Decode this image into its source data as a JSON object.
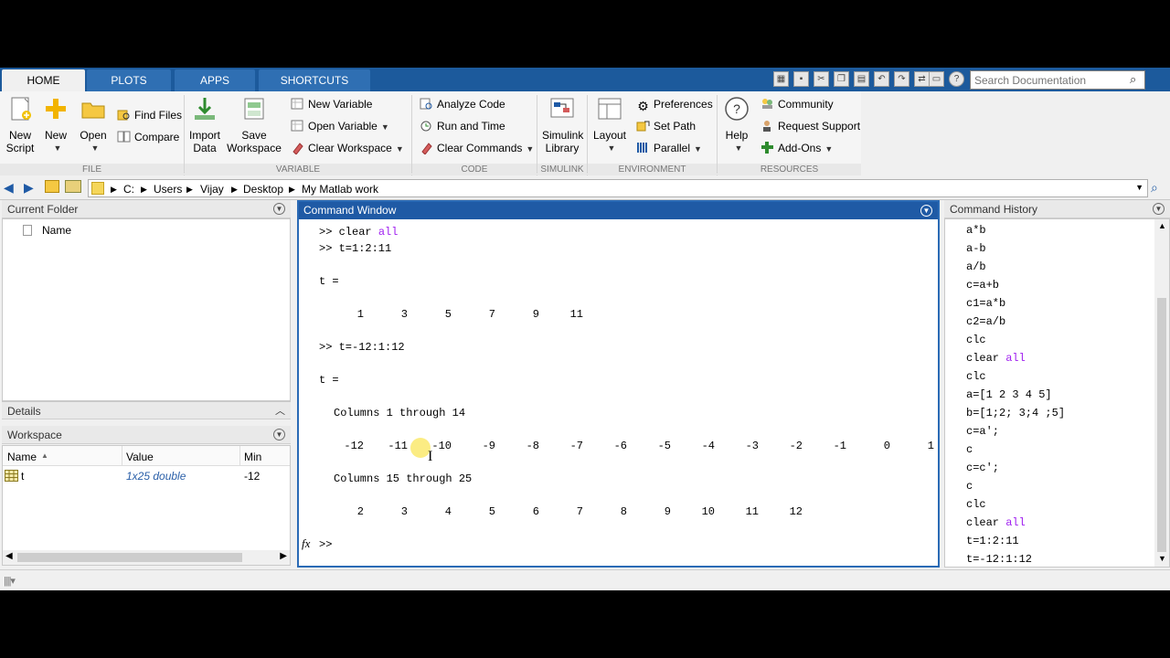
{
  "tabs": [
    "HOME",
    "PLOTS",
    "APPS",
    "SHORTCUTS"
  ],
  "search": {
    "placeholder": "Search Documentation"
  },
  "ribbon": {
    "file": {
      "label": "FILE",
      "new_script": [
        "New",
        "Script"
      ],
      "new": "New",
      "open": "Open",
      "find_files": "Find Files",
      "compare": "Compare"
    },
    "variable": {
      "label": "VARIABLE",
      "import_data": [
        "Import",
        "Data"
      ],
      "save_workspace": [
        "Save",
        "Workspace"
      ],
      "new_variable": "New Variable",
      "open_variable": "Open Variable",
      "clear_workspace": "Clear Workspace"
    },
    "code": {
      "label": "CODE",
      "analyze_code": "Analyze Code",
      "run_and_time": "Run and Time",
      "clear_commands": "Clear Commands"
    },
    "simulink": {
      "label": "SIMULINK",
      "simulink_library": [
        "Simulink",
        "Library"
      ]
    },
    "environment": {
      "label": "ENVIRONMENT",
      "layout": "Layout",
      "preferences": "Preferences",
      "set_path": "Set Path",
      "parallel": "Parallel"
    },
    "resources": {
      "label": "RESOURCES",
      "help": "Help",
      "community": "Community",
      "request_support": "Request Support",
      "add_ons": "Add-Ons"
    }
  },
  "address": {
    "path": [
      "C:",
      "Users",
      "Vijay",
      "Desktop",
      "My Matlab work"
    ]
  },
  "current_folder": {
    "title": "Current Folder",
    "column_name": "Name"
  },
  "details": {
    "title": "Details"
  },
  "workspace": {
    "title": "Workspace",
    "columns": [
      "Name",
      "Value",
      "Min"
    ],
    "rows": [
      {
        "name": "t",
        "value": "1x25 double",
        "min": "-12"
      }
    ]
  },
  "command_window": {
    "title": "Command Window",
    "lines": {
      "l1_prompt": ">> clear ",
      "l1_kw": "all",
      "l2": ">> t=1:2:11",
      "l3": "t =",
      "l4": ">> t=-12:1:12",
      "l5": "t =",
      "l6": "Columns 1 through 14",
      "l7": "Columns 15 through 25",
      "prompt": ">>"
    },
    "row_a": [
      "1",
      "3",
      "5",
      "7",
      "9",
      "11"
    ],
    "row_b": [
      "-12",
      "-11",
      "-10",
      "-9",
      "-8",
      "-7",
      "-6",
      "-5",
      "-4",
      "-3",
      "-2",
      "-1",
      "0",
      "1"
    ],
    "row_c": [
      "2",
      "3",
      "4",
      "5",
      "6",
      "7",
      "8",
      "9",
      "10",
      "11",
      "12"
    ]
  },
  "command_history": {
    "title": "Command History",
    "items": [
      {
        "t": "a*b",
        "kw": ""
      },
      {
        "t": "a-b",
        "kw": ""
      },
      {
        "t": "a/b",
        "kw": ""
      },
      {
        "t": "c=a+b",
        "kw": ""
      },
      {
        "t": "c1=a*b",
        "kw": ""
      },
      {
        "t": "c2=a/b",
        "kw": ""
      },
      {
        "t": "clc",
        "kw": ""
      },
      {
        "t": "clear ",
        "kw": "all"
      },
      {
        "t": "clc",
        "kw": ""
      },
      {
        "t": "a=[1 2 3 4 5]",
        "kw": ""
      },
      {
        "t": "b=[1;2; 3;4 ;5]",
        "kw": ""
      },
      {
        "t": "c=a';",
        "kw": ""
      },
      {
        "t": "c",
        "kw": ""
      },
      {
        "t": "c=c';",
        "kw": ""
      },
      {
        "t": "c",
        "kw": ""
      },
      {
        "t": "clc",
        "kw": ""
      },
      {
        "t": "clear ",
        "kw": "all"
      },
      {
        "t": "t=1:2:11",
        "kw": ""
      },
      {
        "t": "t=-12:1:12",
        "kw": ""
      }
    ]
  },
  "colors": {
    "accent": "#1f5aa5",
    "keyword": "#a020f0"
  }
}
